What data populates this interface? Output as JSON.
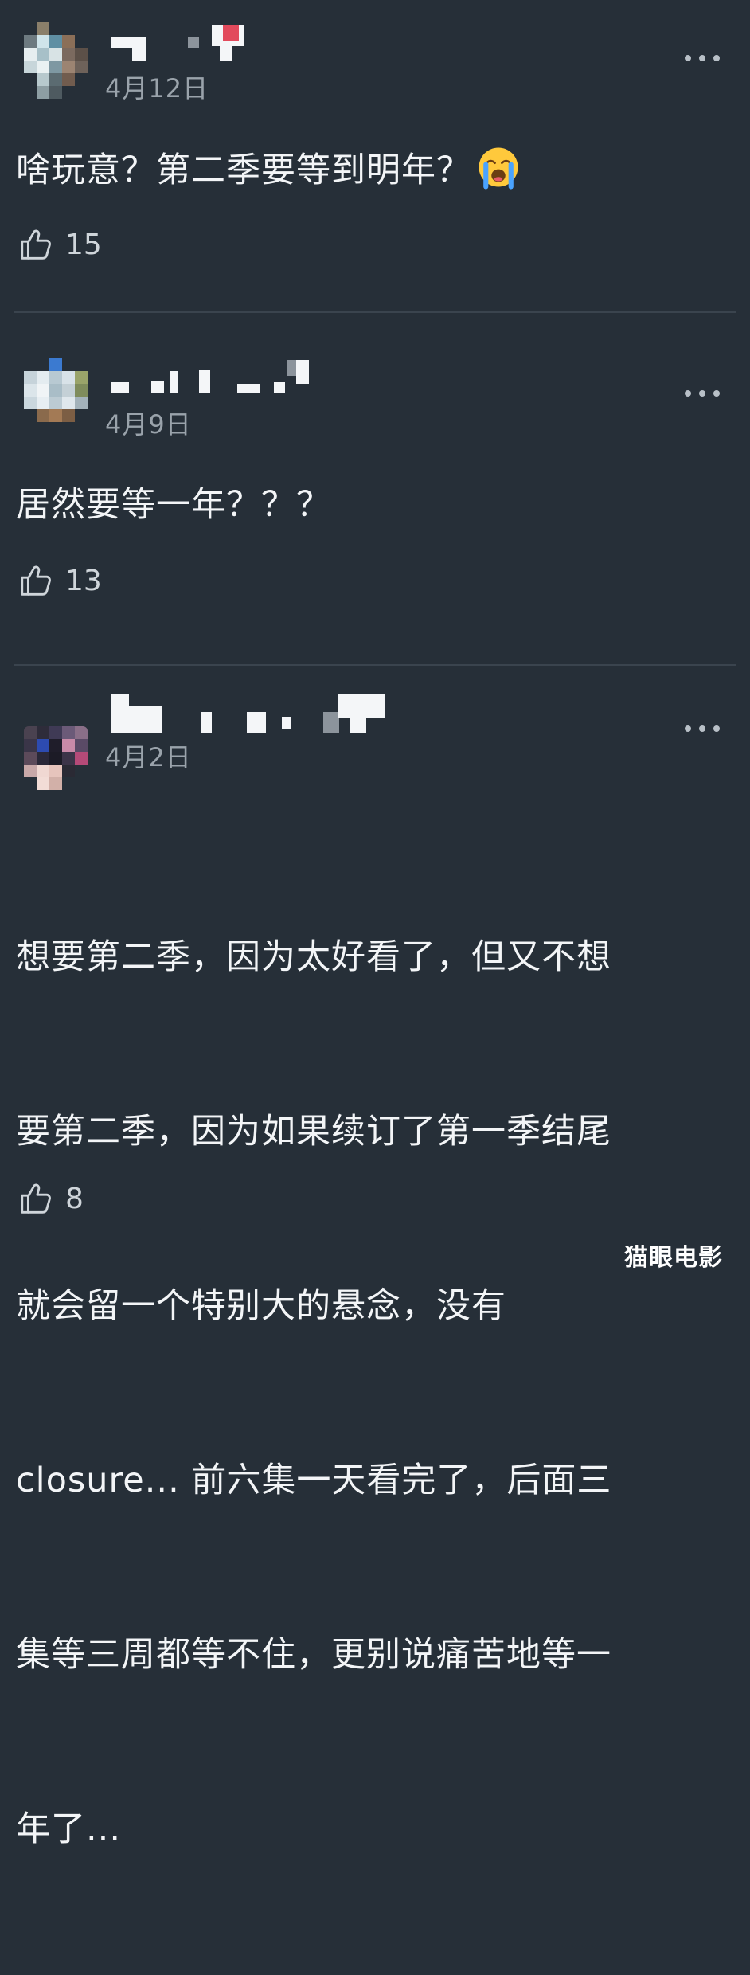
{
  "comments": [
    {
      "date": "4月12日",
      "text": "啥玩意？第二季要等到明年？",
      "emoji": "loudly-crying-face-icon",
      "likes": "15"
    },
    {
      "date": "4月9日",
      "text": "居然要等一年？？？",
      "likes": "13"
    },
    {
      "date": "4月2日",
      "lines": [
        "想要第二季，因为太好看了，但又不想",
        "要第二季，因为如果续订了第一季结尾",
        "就会留一个特别大的悬念，没有",
        "closure... 前六集一天看完了，后面三",
        "集等三周都等不住，更别说痛苦地等一",
        "年了..."
      ],
      "likes": "8"
    }
  ],
  "watermark": "猫眼电影",
  "colors": {
    "background": "#262f38",
    "text": "#f3f5f7",
    "muted": "#9aa3ab",
    "divider": "#3a444e"
  }
}
